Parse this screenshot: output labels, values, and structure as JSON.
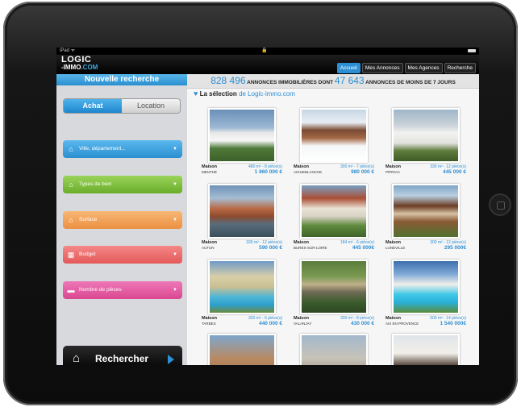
{
  "status": {
    "carrier": "iPad ᯤ",
    "lock": "🔒"
  },
  "logo": {
    "line1": "LOGIC",
    "line2_prefix": "-IMMO",
    "line2_suffix": ".COM"
  },
  "nav": [
    {
      "label": "Accueil",
      "active": true
    },
    {
      "label": "Mes Annonces",
      "active": false
    },
    {
      "label": "Mes Agences",
      "active": false
    },
    {
      "label": "Recherche",
      "active": false
    }
  ],
  "sidebar": {
    "title": "Nouvelle recherche",
    "segments": {
      "buy": "Achat",
      "rent": "Location"
    },
    "fields": [
      {
        "label": "Ville, département...",
        "icon": "house-icon",
        "color": "#3aa2df"
      },
      {
        "label": "Types de bien",
        "icon": "home-icon",
        "color": "#7fbf3a"
      },
      {
        "label": "Surface",
        "icon": "home-outline-icon",
        "color": "#f2a25b"
      },
      {
        "label": "Budget",
        "icon": "calculator-icon",
        "color": "#ee6c6c"
      },
      {
        "label": "Nombre de pièces",
        "icon": "bed-icon",
        "color": "#e45aa6"
      }
    ],
    "search_button": "Rechercher"
  },
  "stats": {
    "count1": "828 496",
    "text1": "ANNONCES IMMOBILIÈRES DONT",
    "count2": "47 643",
    "text2": "ANNONCES DE MOINS DE 7 JOURS"
  },
  "selection": {
    "prefix": "La sélection",
    "suffix": "de Logic-immo.com"
  },
  "listings": [
    {
      "type": "Maison",
      "info": "480 m² - 8 pièce(s)",
      "location": "MENTHE",
      "price": "1 860 000 €"
    },
    {
      "type": "Maison",
      "info": "300 m² - 7 pièce(s)",
      "location": "AIGUEBLANCHE",
      "price": "980 000 €"
    },
    {
      "type": "Maison",
      "info": "330 m² - 12 pièce(s)",
      "location": "PIPRIAC",
      "price": "445 000 €"
    },
    {
      "type": "Maison",
      "info": "330 m² - 12 pièce(s)",
      "location": "AUTUN",
      "price": "590 000 €"
    },
    {
      "type": "Maison",
      "info": "184 m² - 6 pièce(s)",
      "location": "BURES-SUR-LOIRE",
      "price": "445 000€"
    },
    {
      "type": "Maison",
      "info": "300 m² - 12 pièce(s)",
      "location": "LUNEVILLE",
      "price": "295 000€"
    },
    {
      "type": "Maison",
      "info": "320 m² - 6 pièce(s)",
      "location": "TARBES",
      "price": "440 000 €"
    },
    {
      "type": "Maison",
      "info": "330 m² - 8 pièce(s)",
      "location": "VALANJAY",
      "price": "430 000 €"
    },
    {
      "type": "Maison",
      "info": "500 m² - 14 pièce(s)",
      "location": "AIX EN PROVENCE",
      "price": "1 540 000€"
    },
    {
      "type": "",
      "info": "",
      "location": "",
      "price": ""
    },
    {
      "type": "",
      "info": "",
      "location": "",
      "price": ""
    },
    {
      "type": "",
      "info": "",
      "location": "",
      "price": ""
    }
  ]
}
